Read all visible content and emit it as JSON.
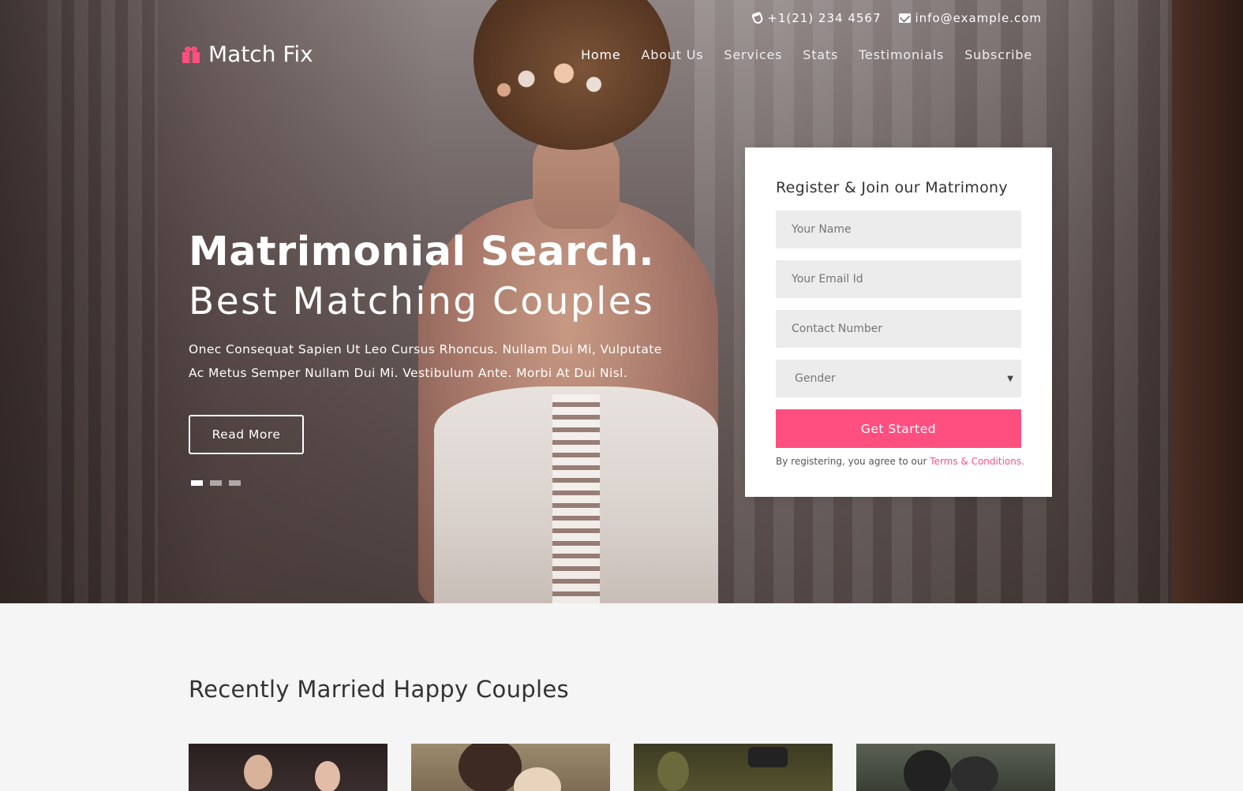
{
  "topbar": {
    "phone": "+1(21) 234 4567",
    "email": "info@example.com"
  },
  "brand": {
    "name": "Match Fix",
    "icon": "gift-icon",
    "accent": "#ff4f81"
  },
  "nav": {
    "items": [
      {
        "label": "Home",
        "active": true
      },
      {
        "label": "About Us"
      },
      {
        "label": "Services"
      },
      {
        "label": "Stats"
      },
      {
        "label": "Testimonials"
      },
      {
        "label": "Subscribe"
      }
    ]
  },
  "hero": {
    "title": "Matrimonial Search.",
    "subtitle": "Best Matching Couples",
    "description": "Onec Consequat Sapien Ut Leo Cursus Rhoncus. Nullam Dui Mi, Vulputate Ac Metus Semper Nullam Dui Mi. Vestibulum Ante. Morbi At Dui Nisl.",
    "cta_label": "Read More",
    "slides": 3,
    "active_slide": 1
  },
  "register": {
    "title": "Register & Join our Matrimony",
    "name_placeholder": "Your Name",
    "email_placeholder": "Your Email Id",
    "phone_placeholder": "Contact Number",
    "gender_selected": "Gender",
    "submit_label": "Get Started",
    "terms_prefix": "By registering, you agree to our ",
    "terms_link": "Terms & Conditions."
  },
  "couples": {
    "title": "Recently Married Happy Couples"
  }
}
